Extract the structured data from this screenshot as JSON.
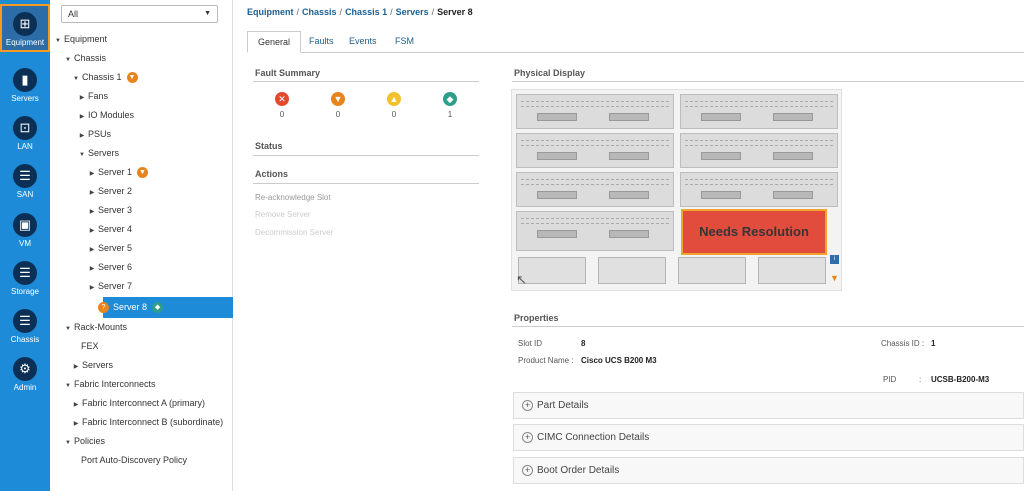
{
  "rail": [
    {
      "label": "Equipment",
      "icon": "equipment-icon",
      "glyph": "⊞",
      "active": true
    },
    {
      "label": "Servers",
      "icon": "servers-icon",
      "glyph": "▮"
    },
    {
      "label": "LAN",
      "icon": "lan-icon",
      "glyph": "⊡"
    },
    {
      "label": "SAN",
      "icon": "san-icon",
      "glyph": "☰"
    },
    {
      "label": "VM",
      "icon": "vm-icon",
      "glyph": "▣"
    },
    {
      "label": "Storage",
      "icon": "storage-icon",
      "glyph": "☰"
    },
    {
      "label": "Chassis",
      "icon": "chassis-icon",
      "glyph": "☰"
    },
    {
      "label": "Admin",
      "icon": "admin-icon",
      "glyph": "⚙"
    }
  ],
  "tree": {
    "filter": "All",
    "nodes": [
      {
        "label": "Equipment",
        "expanded": true
      },
      {
        "label": "Chassis",
        "expanded": true
      },
      {
        "label": "Chassis 1",
        "expanded": true
      },
      {
        "label": "Fans"
      },
      {
        "label": "IO Modules"
      },
      {
        "label": "PSUs"
      },
      {
        "label": "Servers",
        "expanded": true
      },
      {
        "label": "Server 1"
      },
      {
        "label": "Server 2"
      },
      {
        "label": "Server 3"
      },
      {
        "label": "Server 4"
      },
      {
        "label": "Server 5"
      },
      {
        "label": "Server 6"
      },
      {
        "label": "Server 7"
      },
      {
        "label": "Server 8",
        "selected": true
      },
      {
        "label": "Rack-Mounts",
        "expanded": true
      },
      {
        "label": "FEX"
      },
      {
        "label": "Servers"
      },
      {
        "label": "Fabric Interconnects",
        "expanded": true
      },
      {
        "label": "Fabric Interconnect A (primary)"
      },
      {
        "label": "Fabric Interconnect B (subordinate)"
      },
      {
        "label": "Policies",
        "expanded": true
      },
      {
        "label": "Port Auto-Discovery Policy"
      }
    ]
  },
  "breadcrumb": [
    "Equipment",
    "Chassis",
    "Chassis 1",
    "Servers",
    "Server 8"
  ],
  "tabs": [
    "General",
    "Faults",
    "Events",
    "FSM"
  ],
  "fault_summary": {
    "title": "Fault Summary",
    "items": [
      {
        "severity": "critical",
        "glyph": "✕",
        "color": "#e04a2f",
        "count": "0"
      },
      {
        "severity": "major",
        "glyph": "▼",
        "color": "#e8841e",
        "count": "0"
      },
      {
        "severity": "minor",
        "glyph": "▲",
        "color": "#f2c12e",
        "count": "0"
      },
      {
        "severity": "warning",
        "glyph": "◆",
        "color": "#2e9e8a",
        "count": "1"
      }
    ]
  },
  "status_title": "Status",
  "actions": {
    "title": "Actions",
    "items": [
      {
        "label": "Re-acknowledge Slot",
        "enabled": true
      },
      {
        "label": "Remove Server",
        "enabled": false
      },
      {
        "label": "Decommission Server",
        "enabled": false
      }
    ]
  },
  "physical_display": {
    "title": "Physical Display",
    "overlay": "Needs Resolution"
  },
  "properties": {
    "title": "Properties",
    "slot_id_label": "Slot ID",
    "slot_id": "8",
    "chassis_id_label": "Chassis ID :",
    "chassis_id": "1",
    "product_name_label": "Product Name :",
    "product_name": "Cisco UCS B200 M3",
    "pid_label": "PID",
    "pid_sep": ":",
    "pid": "UCSB-B200-M3"
  },
  "accordions": [
    "Part Details",
    "CIMC Connection Details",
    "Boot Order Details"
  ],
  "colors": {
    "accent": "#1e8bd8",
    "selection": "#1e8bd8",
    "highlight": "#f39c1f"
  }
}
